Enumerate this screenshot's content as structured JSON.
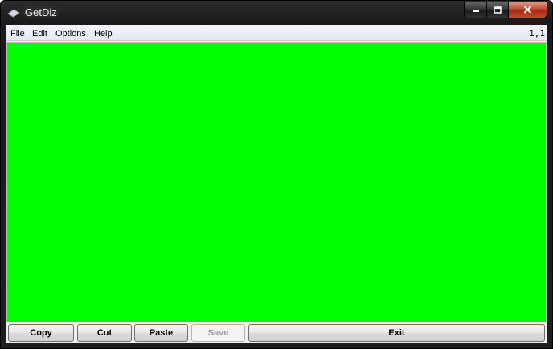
{
  "window": {
    "title": "GetDiz"
  },
  "menu": {
    "items": [
      "File",
      "Edit",
      "Options",
      "Help"
    ],
    "cursor_position": "1,1"
  },
  "editor": {
    "background_color": "#00ff00",
    "content": ""
  },
  "buttons": {
    "copy": "Copy",
    "cut": "Cut",
    "paste": "Paste",
    "save": "Save",
    "exit": "Exit"
  },
  "icons": {
    "app": "app-icon",
    "minimize": "minimize-icon",
    "maximize": "maximize-icon",
    "close": "close-icon"
  }
}
